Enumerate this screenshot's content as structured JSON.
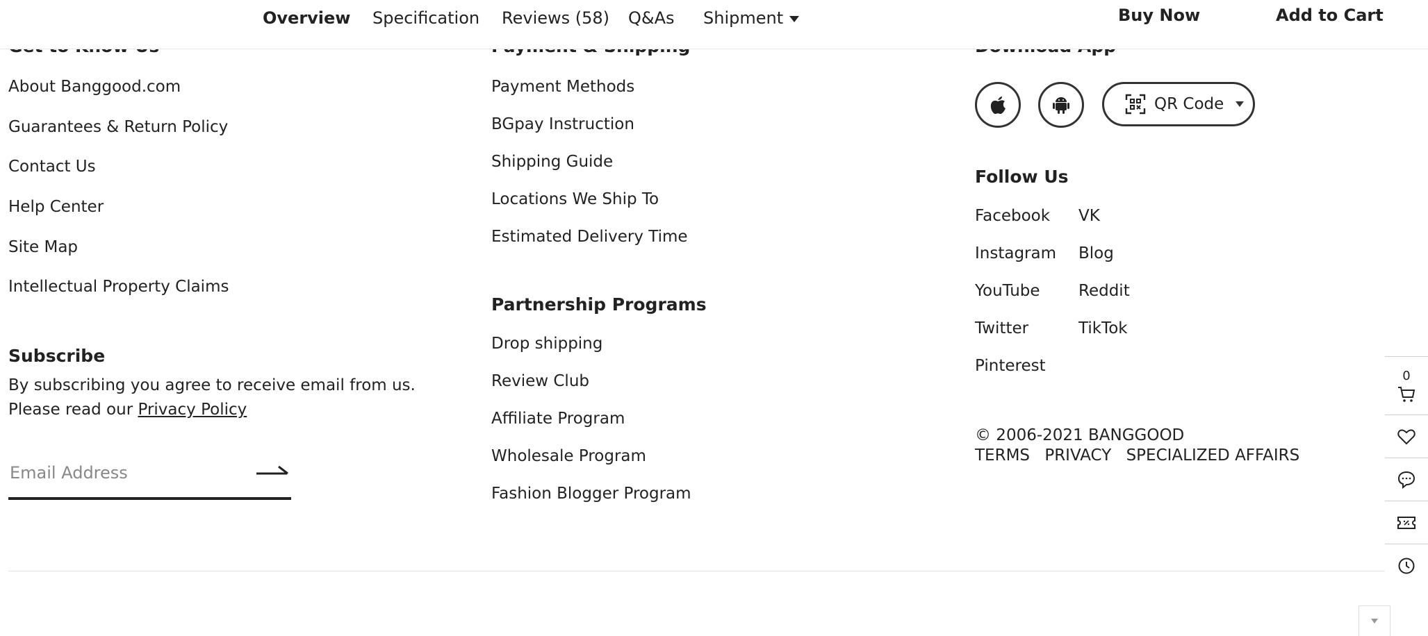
{
  "nav": {
    "tabs": [
      {
        "label": "Overview"
      },
      {
        "label": "Specification"
      },
      {
        "label": "Reviews (58)"
      },
      {
        "label": "Q&As"
      },
      {
        "label": "Shipment"
      }
    ],
    "buy_now": "Buy Now",
    "add_to_cart": "Add to Cart"
  },
  "footer": {
    "col1": {
      "heading": "Get to Know Us",
      "links": [
        "About Banggood.com",
        "Guarantees & Return Policy",
        "Contact Us",
        "Help Center",
        "Site Map",
        "Intellectual Property Claims"
      ]
    },
    "subscribe": {
      "heading": "Subscribe",
      "line1": "By subscribing you agree to receive email from us.",
      "line2_prefix": "Please read our ",
      "privacy_link": "Privacy Policy",
      "email_placeholder": "Email Address"
    },
    "col2": {
      "heading": "Payment & Shipping",
      "links": [
        "Payment Methods",
        "BGpay Instruction",
        "Shipping Guide",
        "Locations We Ship To",
        "Estimated Delivery Time"
      ]
    },
    "partnership": {
      "heading": "Partnership Programs",
      "links": [
        "Drop shipping",
        "Review Club",
        "Affiliate Program",
        "Wholesale Program",
        "Fashion Blogger Program"
      ]
    },
    "app": {
      "heading": "Download App",
      "ios_icon": "apple-icon",
      "android_icon": "android-icon",
      "qr_label": "QR Code"
    },
    "follow": {
      "heading": "Follow Us",
      "left": [
        "Facebook",
        "Instagram",
        "YouTube",
        "Twitter",
        "Pinterest"
      ],
      "right": [
        "VK",
        "Blog",
        "Reddit",
        "TikTok"
      ]
    },
    "copyright": "© 2006-2021 BANGGOOD",
    "legal": [
      "TERMS",
      "PRIVACY",
      "SPECIALIZED AFFAIRS"
    ]
  },
  "sidebar": {
    "cart_count": "0",
    "icons": [
      "cart-icon",
      "heart-icon",
      "chat-icon",
      "coupon-icon",
      "history-icon"
    ]
  }
}
